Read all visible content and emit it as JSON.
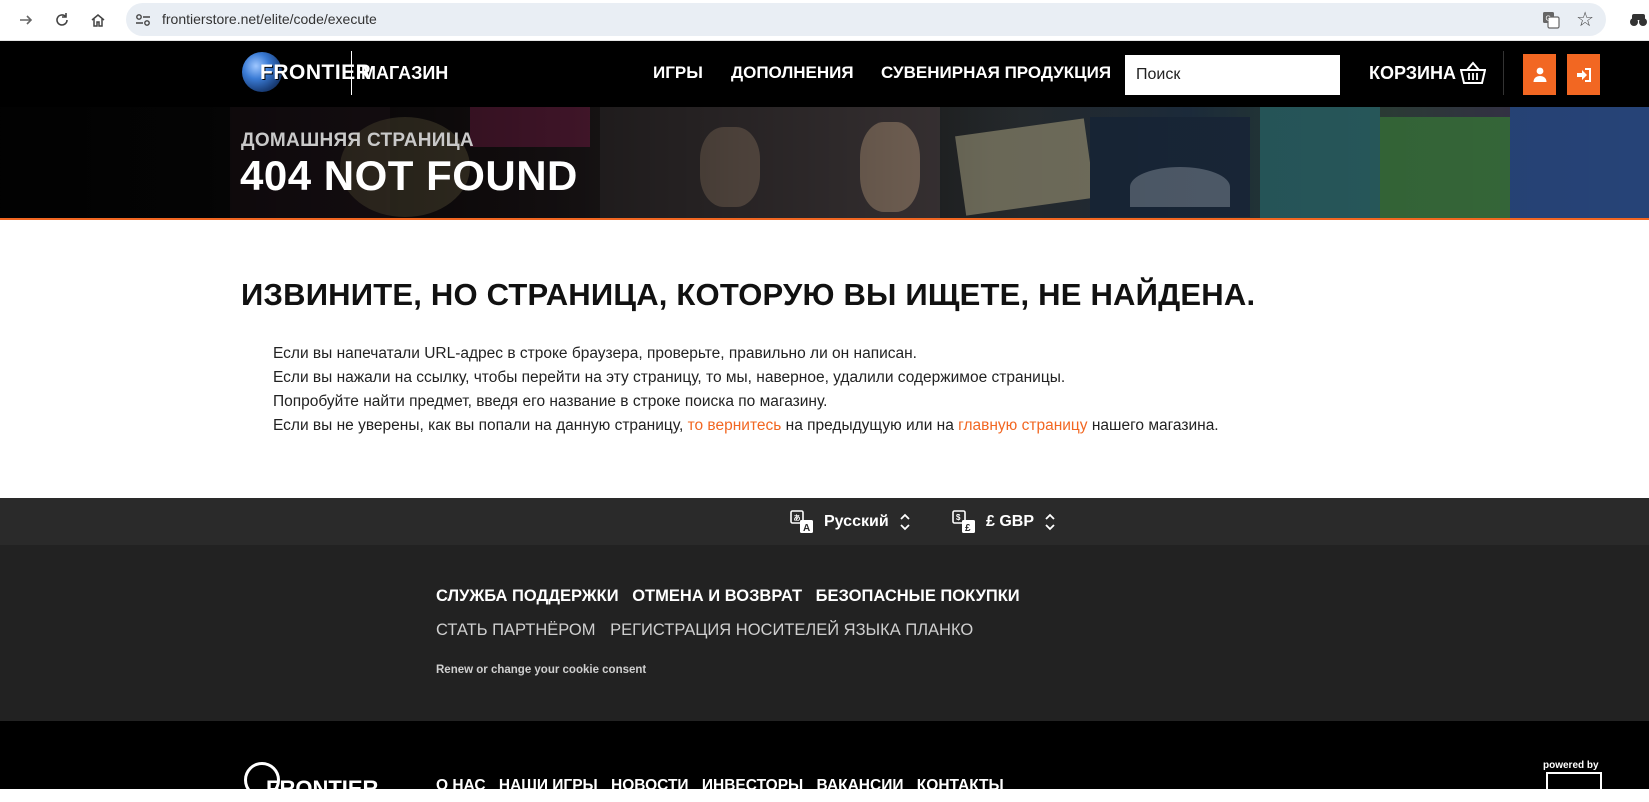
{
  "browser": {
    "url": "frontierstore.net/elite/code/execute"
  },
  "header": {
    "logo_text": "FRONTIER",
    "shop_label": "МАГАЗИН",
    "nav": [
      "ИГРЫ",
      "ДОПОЛНЕНИЯ",
      "СУВЕНИРНАЯ ПРОДУКЦИЯ"
    ],
    "search_placeholder": "Поиск",
    "cart_label": "КОРЗИНА",
    "accent_color": "#f26722"
  },
  "hero": {
    "breadcrumb": "ДОМАШНЯЯ СТРАНИЦА",
    "title": "404 NOT FOUND"
  },
  "main": {
    "heading": "ИЗВИНИТЕ, НО СТРАНИЦА, КОТОРУЮ ВЫ ИЩЕТЕ, НЕ НАЙДЕНА.",
    "line1": "Если вы напечатали URL-адрес в строке браузера, проверьте, правильно ли он написан.",
    "line2": "Если вы нажали на ссылку, чтобы перейти на эту страницу, то мы, наверное, удалили содержимое страницы.",
    "line3": "Попробуйте найти предмет, введя его название в строке поиска по магазину.",
    "line4_part1": "Если вы не уверены, как вы попали на данную страницу, ",
    "line4_link1": "то вернитесь",
    "line4_part2": " на предыдущую или на ",
    "line4_link2": "главную страницу",
    "line4_part3": " нашего магазина."
  },
  "footer": {
    "language": "Русский",
    "currency": "£ GBP",
    "links_primary": [
      "СЛУЖБА ПОДДЕРЖКИ",
      "ОТМЕНА И ВОЗВРАТ",
      "БЕЗОПАСНЫЕ ПОКУПКИ"
    ],
    "links_secondary": [
      "СТАТЬ ПАРТНЁРОМ",
      "РЕГИСТРАЦИЯ НОСИТЕЛЕЙ ЯЗЫКА ПЛАНКО"
    ],
    "cookie_text": "Renew or change your cookie consent",
    "bottom_logo": "FRONTIER",
    "bottom_links": [
      "О НАС",
      "НАШИ ИГРЫ",
      "НОВОСТИ",
      "ИНВЕСТОРЫ",
      "ВАКАНСИИ",
      "КОНТАКТЫ"
    ],
    "powered_by": "powered by"
  }
}
